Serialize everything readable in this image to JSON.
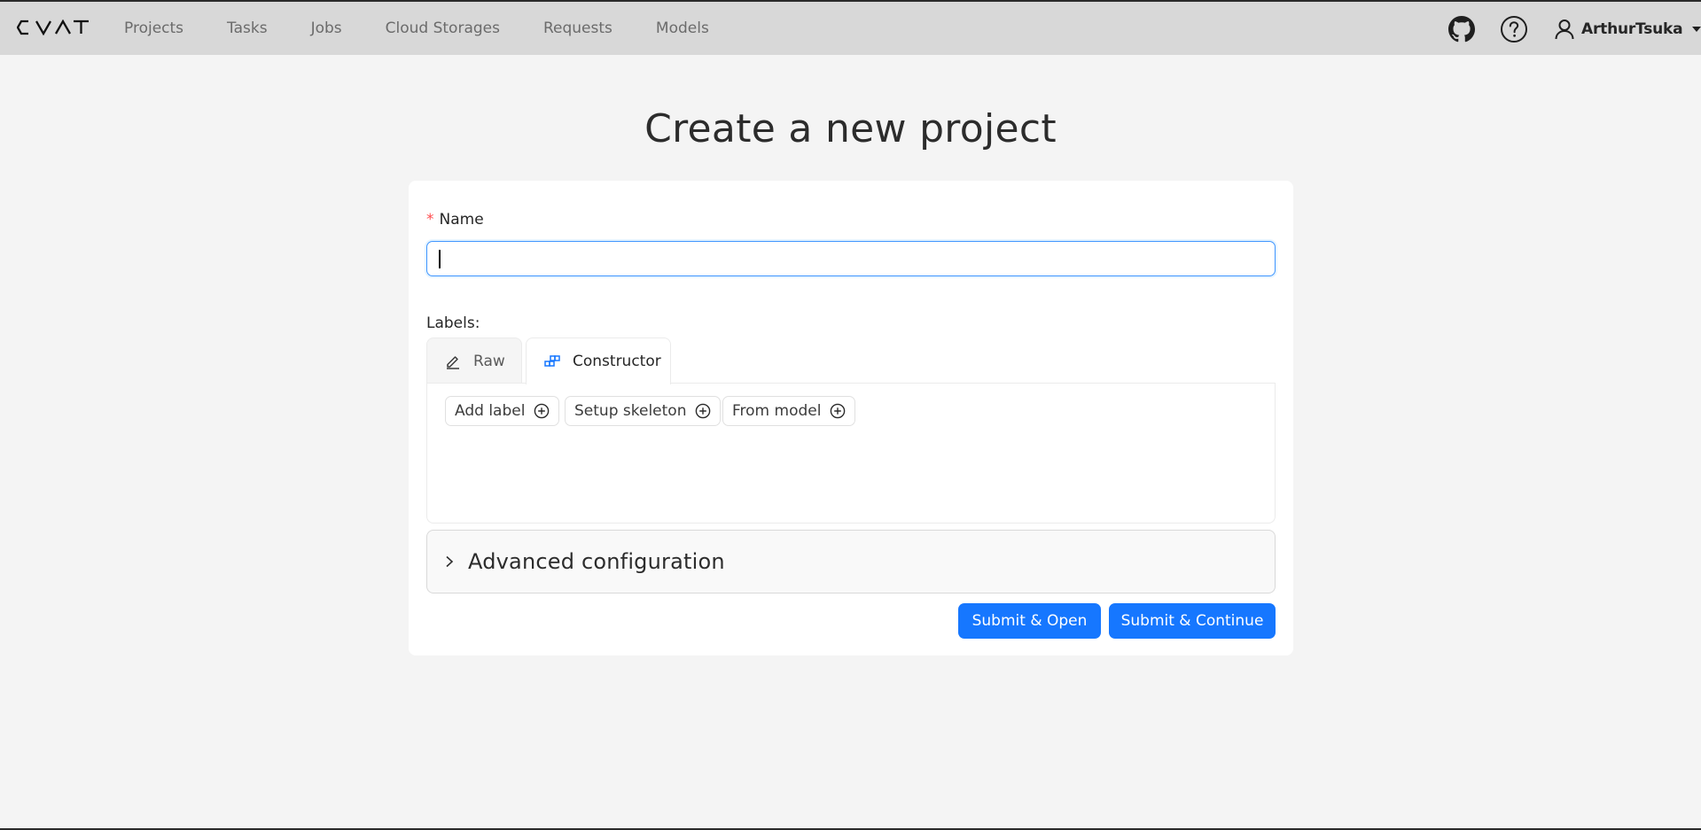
{
  "header": {
    "logo_text": "CVAT",
    "nav": [
      "Projects",
      "Tasks",
      "Jobs",
      "Cloud Storages",
      "Requests",
      "Models"
    ],
    "icons": {
      "github": "github-icon",
      "help": "question-circle-icon",
      "user": "user-icon",
      "dropdown": "caret-down-icon"
    },
    "user_name": "ArthurTsuka"
  },
  "page": {
    "title": "Create a new project"
  },
  "form": {
    "name_required_mark": "*",
    "name_label": "Name",
    "name_value": "",
    "labels_label": "Labels:",
    "tabs": [
      {
        "label": "Raw",
        "icon": "edit-icon",
        "active": false
      },
      {
        "label": "Constructor",
        "icon": "build-icon",
        "active": true
      }
    ],
    "constructor_buttons": [
      {
        "label": "Add label",
        "icon": "plus-circle-icon"
      },
      {
        "label": "Setup skeleton",
        "icon": "plus-circle-icon"
      },
      {
        "label": "From model",
        "icon": "plus-circle-icon"
      }
    ],
    "advanced_title": "Advanced configuration",
    "submit_open": "Submit & Open",
    "submit_continue": "Submit & Continue"
  },
  "colors": {
    "header_bg": "#d8d8d8",
    "page_bg": "#f4f4f4",
    "primary": "#1677ff",
    "input_focus": "#4096ff",
    "required": "#ff4d4f"
  }
}
